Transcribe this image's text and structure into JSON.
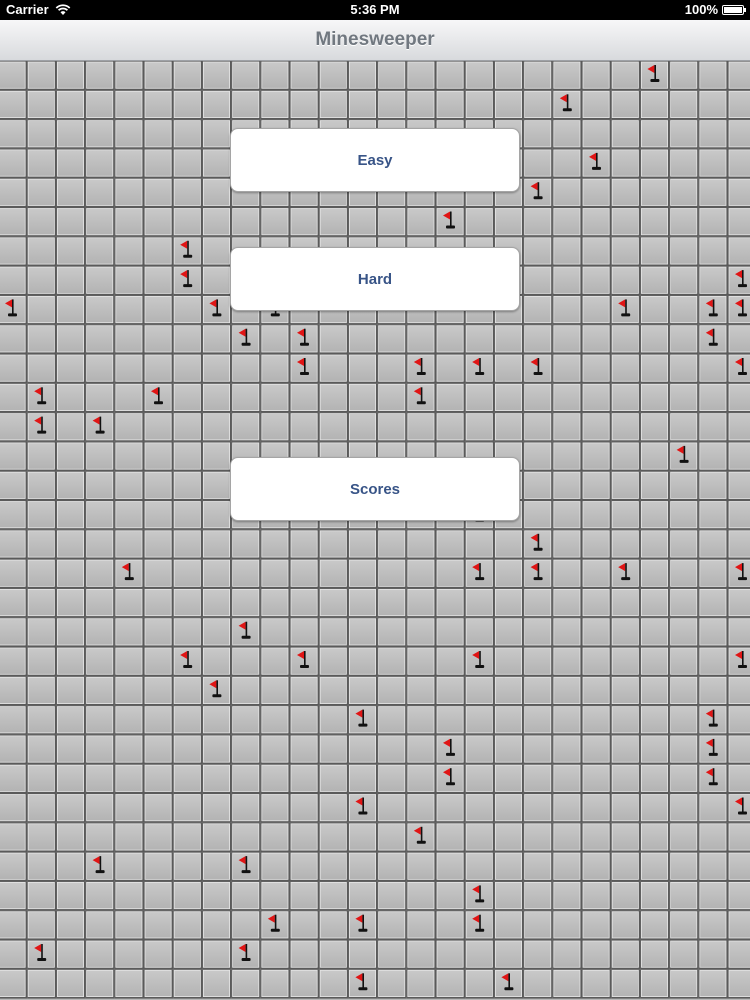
{
  "status_bar": {
    "carrier": "Carrier",
    "time": "5:36 PM",
    "battery": "100%"
  },
  "nav": {
    "title": "Minesweeper"
  },
  "menu": {
    "easy_label": "Easy",
    "hard_label": "Hard",
    "scores_label": "Scores"
  },
  "board": {
    "columns": 26,
    "rows": 32,
    "flag_color": "#e01515",
    "flags": [
      [
        22,
        0
      ],
      [
        19,
        1
      ],
      [
        20,
        3
      ],
      [
        18,
        4
      ],
      [
        15,
        5
      ],
      [
        6,
        6
      ],
      [
        6,
        7
      ],
      [
        25,
        7
      ],
      [
        0,
        8
      ],
      [
        7,
        8
      ],
      [
        9,
        8
      ],
      [
        21,
        8
      ],
      [
        24,
        8
      ],
      [
        25,
        8
      ],
      [
        8,
        9
      ],
      [
        10,
        9
      ],
      [
        24,
        9
      ],
      [
        10,
        10
      ],
      [
        14,
        10
      ],
      [
        16,
        10
      ],
      [
        18,
        10
      ],
      [
        25,
        10
      ],
      [
        1,
        11
      ],
      [
        5,
        11
      ],
      [
        14,
        11
      ],
      [
        1,
        12
      ],
      [
        3,
        12
      ],
      [
        23,
        13
      ],
      [
        16,
        15
      ],
      [
        18,
        16
      ],
      [
        4,
        17
      ],
      [
        16,
        17
      ],
      [
        18,
        17
      ],
      [
        21,
        17
      ],
      [
        25,
        17
      ],
      [
        8,
        19
      ],
      [
        6,
        20
      ],
      [
        10,
        20
      ],
      [
        16,
        20
      ],
      [
        25,
        20
      ],
      [
        7,
        21
      ],
      [
        12,
        22
      ],
      [
        24,
        22
      ],
      [
        15,
        23
      ],
      [
        24,
        23
      ],
      [
        15,
        24
      ],
      [
        24,
        24
      ],
      [
        12,
        25
      ],
      [
        25,
        25
      ],
      [
        14,
        26
      ],
      [
        3,
        27
      ],
      [
        8,
        27
      ],
      [
        16,
        28
      ],
      [
        9,
        29
      ],
      [
        12,
        29
      ],
      [
        16,
        29
      ],
      [
        1,
        30
      ],
      [
        8,
        30
      ],
      [
        12,
        31
      ],
      [
        17,
        31
      ]
    ]
  }
}
